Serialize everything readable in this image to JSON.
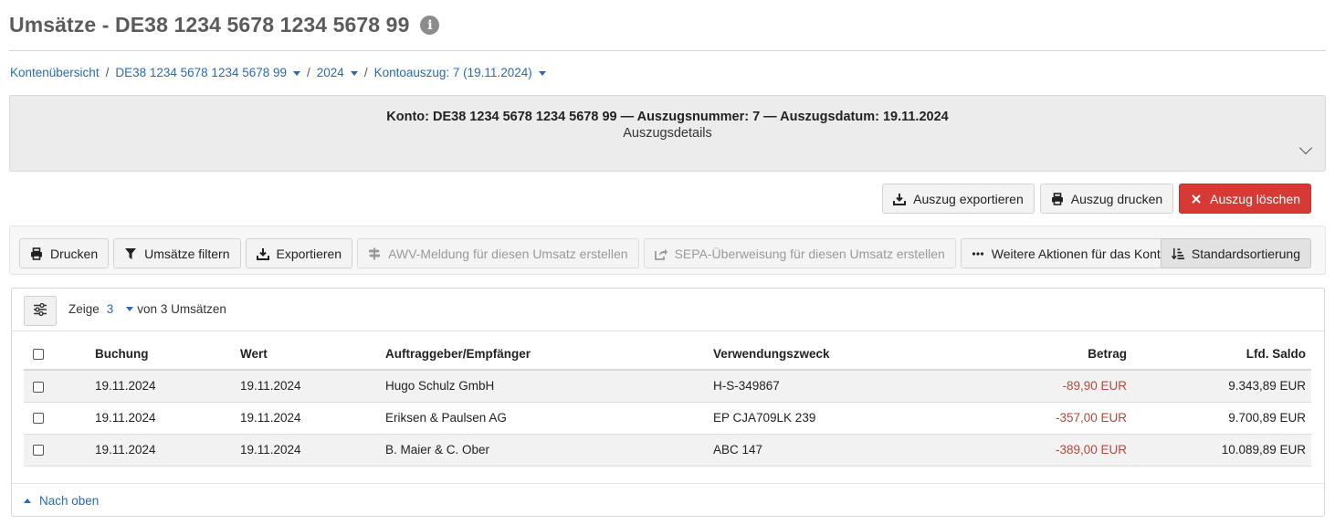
{
  "page": {
    "title": "Umsätze - DE38 1234 5678 1234 5678 99",
    "info_icon": "info-icon"
  },
  "breadcrumb": {
    "items": [
      "Kontenübersicht",
      "DE38 1234 5678 1234 5678 99",
      "2024",
      "Kontoauszug: 7 (19.11.2024)"
    ],
    "separator": "/"
  },
  "statement": {
    "header": "Konto: DE38 1234 5678 1234 5678 99 — Auszugsnummer: 7 — Auszugsdatum: 19.11.2024",
    "details_label": "Auszugsdetails",
    "export_label": "Auszug exportieren",
    "print_label": "Auszug drucken",
    "delete_label": "Auszug löschen"
  },
  "toolbar": {
    "print_label": "Drucken",
    "filter_label": "Umsätze filtern",
    "export_label": "Exportieren",
    "awv_label": "AWV-Meldung für diesen Umsatz erstellen",
    "sepa_label": "SEPA-Überweisung für diesen Umsatz erstellen",
    "more_label": "Weitere Aktionen für das Konto",
    "sort_label": "Standardsortierung"
  },
  "table": {
    "show_label": "Zeige",
    "show_count": "3",
    "of_label": "von 3 Umsätzen",
    "columns": [
      "Buchung",
      "Wert",
      "Auftraggeber/Empfänger",
      "Verwendungszweck",
      "Betrag",
      "Lfd. Saldo"
    ],
    "rows": [
      {
        "buchung": "19.11.2024",
        "wert": "19.11.2024",
        "partner": "Hugo Schulz GmbH",
        "zweck": "H-S-349867",
        "betrag": "-89,90 EUR",
        "saldo": "9.343,89 EUR"
      },
      {
        "buchung": "19.11.2024",
        "wert": "19.11.2024",
        "partner": "Eriksen & Paulsen AG",
        "zweck": "EP CJA709LK 239",
        "betrag": "-357,00 EUR",
        "saldo": "9.700,89 EUR"
      },
      {
        "buchung": "19.11.2024",
        "wert": "19.11.2024",
        "partner": "B. Maier & C. Ober",
        "zweck": "ABC 147",
        "betrag": "-389,00 EUR",
        "saldo": "10.089,89 EUR"
      }
    ],
    "back_to_top": "Nach oben"
  },
  "colors": {
    "link": "#2a6ab5",
    "danger": "#d73a35",
    "negative_amount": "#b5483d"
  }
}
